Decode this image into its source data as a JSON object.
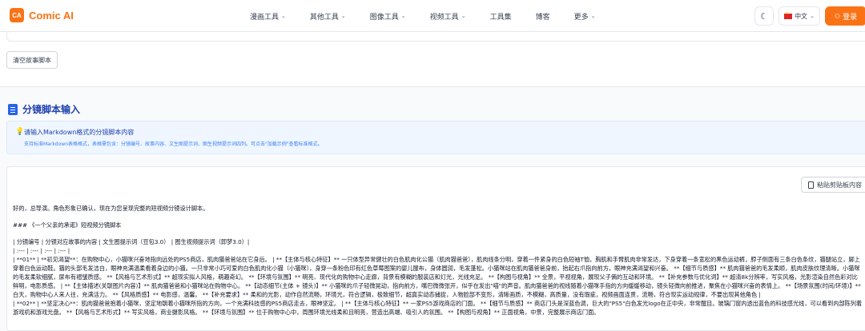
{
  "app": {
    "logo_badge": "CA",
    "logo_text": "Comic AI"
  },
  "nav": [
    {
      "label": "漫画工具",
      "chevron": true
    },
    {
      "label": "其他工具",
      "chevron": true
    },
    {
      "label": "图像工具",
      "chevron": true
    },
    {
      "label": "视频工具",
      "chevron": true
    },
    {
      "label": "工具集",
      "chevron": false
    },
    {
      "label": "博客",
      "chevron": false
    },
    {
      "label": "更多",
      "chevron": true
    }
  ],
  "header": {
    "theme_icon": "moon-icon",
    "language": "中文",
    "login": "登录"
  },
  "actions": {
    "clear_script": "清空故事脚本"
  },
  "section": {
    "title": "分镜脚本输入",
    "hint_title": "请输入Markdown格式的分镜脚本内容",
    "hint_sub": "支持标准Markdown表格格式，表格需包含：分镜编号、故事内容、文生图提示词、图生视频提示词四列。可点击\"加载示例\"查看标准格式。",
    "paste_button": "粘贴剪贴板内容"
  },
  "editor_lines": [
    "好的，总导演。角色形象已确认，现在为您呈现完整的短视频分镜设计脚本。",
    "### 《一个父亲的承诺》短视频分镜脚本",
    "| 分镜编号 | 分镜对应故事的内容 | 文生图提示词（豆包3.0） | 图生视频提示词（即梦3.0）|",
    "| :--- | :--- | :--- | :--- |",
    "| **01** | **初见渴望**：在购物中心，小猫咪兴奋地指向远处的PS5商店，肌肉猫爸爸站在它身后。 | **【主体与核心特征】** 一只体型异常健壮的白色肌肉化公猫（肌肉猫爸爸），肌肉线条分明，穿着一件紧身的白色短袖T恤，胸肌和手臂肌肉非常发达，下身穿着一条宽松的黑色运动裤，脖子侧面有三条白色条纹，猫腿站立，脚上穿着白色运动鞋。猫的头部毛发洁白，眼神充满温柔看着身边的小猫。一只非常小巧可爱的白色肌肉化小猫（小猫咪），身穿一条粉色印有红色草莓图案的婴儿服布，身体圆润，毛发蓬松。小猫咪站在肌肉猫爸爸身前，抬起右爪指向前方，眼神充满渴望和兴奋。 **【细节与质感】** 肌肉猫爸爸的毛发柔顺，肌肉皮肤纹理清晰。小猫咪的毛发柔软细腻，尿布有褶皱质感。 **【风格与艺术形式】** 超现实拟人风格，萌趣奇幻。 **【环境与氛围】** 明亮、现代化的购物中心走廊，背景有模糊的服装店和灯光，光线充足。 **【构图与视角】** 全景，平视视角，展现父子俩的互动和环境。 **【补充参数与优化词】** 超清8k分辨率，写实风格，光影渲染自然色彩对比鲜明，电影质感。 | **【主体描述(关联图片内容)】** 肌肉猫爸爸和小猫咪站在购物中心。 **【动态细节(主体 + 镜头)】** 小猫咪的爪子轻微晃动，指向前方，嘴巴微微张开，似乎在发出\"喵\"的声音。肌肉猫爸爸的视线随着小猫咪手指的方向缓缓移动，镜头轻微向前推进，聚焦在小猫咪兴奋的表情上。 **【场景氛围(时间/环境)】** 白天，购物中心人来人往，充满活力。 **【风格质感】** 电影感，温馨。 **【补充要求】** 柔和的光影，动作自然流畅，环境光，符合逻辑，极致细节，超真实动态捕捉，人物脸部不变形，清晰画质，不模糊，高质量，没有瑕疵，视频画面连贯，流畅，符合现实运动规律，不要出现其他角色 |",
    "| **02** | **坚定决心**：肌肉猫爸爸抱着小猫咪，坚定地朝着小猫咪所指的方向，一个充满科技感的PS5商店走去，眼神坚定。 | **【主体与核心特征】** 一家PS5游戏商店的门面。 **【细节与质感】** 商店门头是深蓝色调，巨大的\"PS5\"白色发光logo在正中央，非常醒目。玻璃门窗内透出蓝色的科技感光线，可以看到内部陈列着游戏机和游戏光盘。 **【风格与艺术形式】** 写实风格，商业摄影风格。 **【环境与氛围】** 位于购物中心中，周围环境光线柔和且明亮，营造出高端、吸引人的氛围。 **【构图与视角】** 正面视角，中景，完整展示商店门面。"
  ]
}
